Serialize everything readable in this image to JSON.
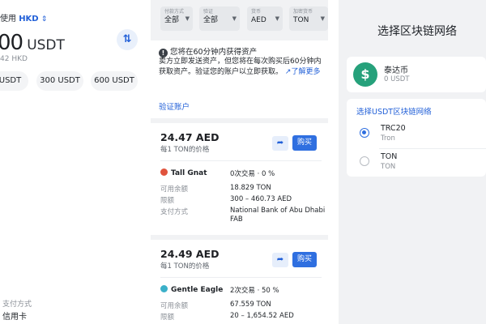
{
  "left_panel": {
    "currency_prefix": "使用",
    "currency_code": "HKD",
    "currency_switch_glyph": "⇕",
    "amount": "00",
    "amount_unit": "USDT",
    "amount_sub": "42 HKD",
    "swap_icon": "⇅",
    "quick_amounts": [
      "USDT",
      "300 USDT",
      "600 USDT"
    ],
    "payment_label": "支付方式",
    "payment_value": "信用卡"
  },
  "middle_panel": {
    "filters": [
      {
        "label": "付款方式",
        "value": "全部"
      },
      {
        "label": "验证",
        "value": "全部"
      },
      {
        "label": "货币",
        "value": "AED"
      },
      {
        "label": "加密货币",
        "value": "TON"
      }
    ],
    "notice": {
      "heading": "您将在60分钟内获得资产",
      "body": "卖方立即发送资产，但您将在每次购买后60分钟内获取资产。验证您的账户以立即获取。",
      "more_link": "了解更多",
      "verify_link": "验证账户"
    },
    "offers": [
      {
        "price": "24.47 AED",
        "per_unit": "每1 TON的价格",
        "buy_label": "购买",
        "merchant": "Tall Gnat",
        "merchant_color": "#e0533d",
        "trades": "0次交易 · 0 %",
        "rows": [
          {
            "key": "可用余额",
            "value": "18.829 TON"
          },
          {
            "key": "限额",
            "value": "300 – 460.73 AED"
          },
          {
            "key": "支付方式",
            "value": "National Bank of Abu Dhabi",
            "value2": "FAB"
          }
        ]
      },
      {
        "price": "24.49 AED",
        "per_unit": "每1 TON的价格",
        "buy_label": "购买",
        "merchant": "Gentle Eagle",
        "merchant_color": "#3bb0c9",
        "trades": "2次交易 · 50 %",
        "rows": [
          {
            "key": "可用余额",
            "value": "67.559 TON"
          },
          {
            "key": "限额",
            "value": "20 – 1,654.52 AED"
          }
        ]
      }
    ]
  },
  "right_panel": {
    "title": "选择区块链网络",
    "coin": {
      "name": "泰达币",
      "balance": "0 USDT",
      "icon": "$",
      "color": "#26a17b"
    },
    "network_heading": "选择USDT区块链网络",
    "networks": [
      {
        "name": "TRC20",
        "sub": "Tron",
        "selected": true
      },
      {
        "name": "TON",
        "sub": "TON",
        "selected": false
      }
    ]
  },
  "colors": {
    "accent": "#2260d8",
    "buy_button": "#2f6fe0",
    "panel_bg": "#f1f2f4"
  }
}
